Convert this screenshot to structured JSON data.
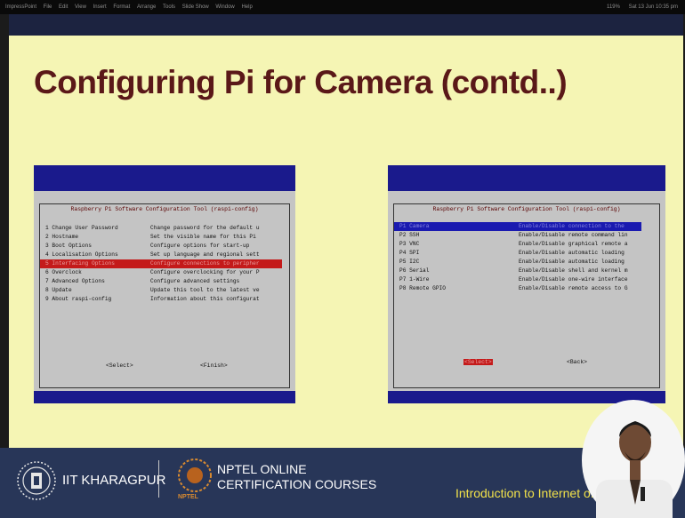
{
  "menubar": {
    "items": [
      "ImpressPoint",
      "File",
      "Edit",
      "View",
      "Insert",
      "Format",
      "Arrange",
      "Tools",
      "Slide Show",
      "Window",
      "Help"
    ],
    "right": [
      "119%",
      "Sat 13 Jun 10:35 pm"
    ]
  },
  "slide": {
    "title": "Configuring Pi for Camera (contd..)"
  },
  "left_screenshot": {
    "frame_title": "Raspberry Pi Software Configuration Tool (raspi-config)",
    "items": [
      {
        "label": "1 Change User Password",
        "desc": "Change password for the default u"
      },
      {
        "label": "2 Hostname",
        "desc": "Set the visible name for this Pi"
      },
      {
        "label": "3 Boot Options",
        "desc": "Configure options for start-up"
      },
      {
        "label": "4 Localisation Options",
        "desc": "Set up language and regional sett"
      },
      {
        "label": "5 Interfacing Options",
        "desc": "Configure connections to peripher"
      },
      {
        "label": "6 Overclock",
        "desc": "Configure overclocking for your P"
      },
      {
        "label": "7 Advanced Options",
        "desc": "Configure advanced settings"
      },
      {
        "label": "8 Update",
        "desc": "Update this tool to the latest ve"
      },
      {
        "label": "9 About raspi-config",
        "desc": "Information about this configurat"
      }
    ],
    "selected_index": 4,
    "select_button": "<Select>",
    "finish_button": "<Finish>"
  },
  "right_screenshot": {
    "frame_title": "Raspberry Pi Software Configuration Tool (raspi-config)",
    "items": [
      {
        "label": "P1 Camera",
        "desc": "Enable/Disable connection to the"
      },
      {
        "label": "P2 SSH",
        "desc": "Enable/Disable remote command lin"
      },
      {
        "label": "P3 VNC",
        "desc": "Enable/Disable graphical remote a"
      },
      {
        "label": "P4 SPI",
        "desc": "Enable/Disable automatic loading"
      },
      {
        "label": "P5 I2C",
        "desc": "Enable/Disable automatic loading"
      },
      {
        "label": "P6 Serial",
        "desc": "Enable/Disable shell and kernel m"
      },
      {
        "label": "P7 1-Wire",
        "desc": "Enable/Disable one-wire interface"
      },
      {
        "label": "P8 Remote GPIO",
        "desc": "Enable/Disable remote access to G"
      }
    ],
    "selected_index": 0,
    "select_button": "<Select>",
    "back_button": "<Back>"
  },
  "footer": {
    "iit_label": "IIT KHARAGPUR",
    "nptel_line1": "NPTEL ONLINE",
    "nptel_line2": "CERTIFICATION COURSES",
    "nptel_logo_text": "NPTEL",
    "course_title": "Introduction to Internet of"
  },
  "colors": {
    "slide_bg": "#f5f5b4",
    "title_color": "#5a1818",
    "raspi_blue": "#1a1a8c",
    "raspi_gray": "#c4c4c4",
    "selection_red": "#c41a1a",
    "footer_bg": "#283658",
    "course_title_color": "#f2e24a"
  }
}
